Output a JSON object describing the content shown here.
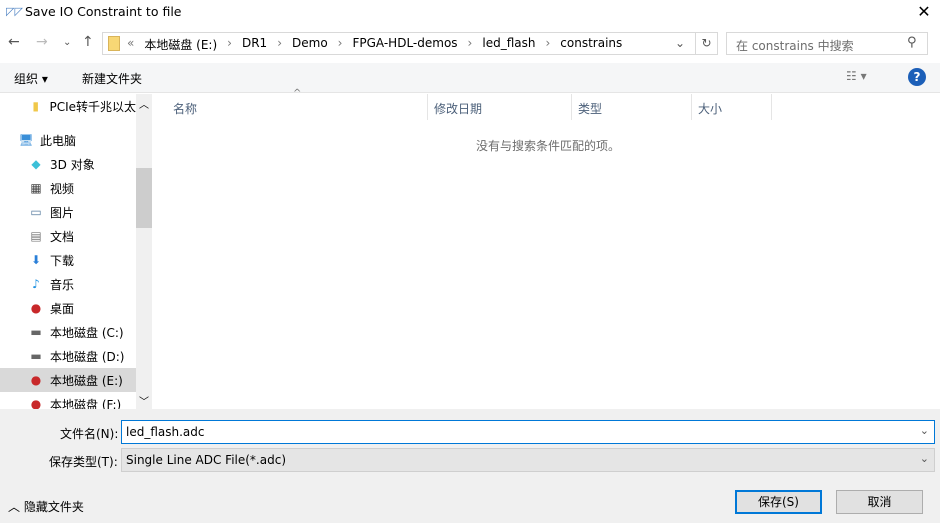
{
  "window": {
    "title": "Save IO Constraint to file",
    "close": "✕"
  },
  "address": {
    "overflow": "«",
    "crumbs": [
      "本地磁盘 (E:)",
      "DR1",
      "Demo",
      "FPGA-HDL-demos",
      "led_flash",
      "constrains"
    ]
  },
  "search": {
    "placeholder": "在 constrains 中搜索"
  },
  "toolbar": {
    "organize": "组织 ▾",
    "new_folder": "新建文件夹"
  },
  "tree": [
    {
      "label": "PCIe转千兆以太",
      "icon": "folder-icon"
    },
    {
      "label": "此电脑",
      "icon": "computer-icon"
    },
    {
      "label": "3D 对象",
      "icon": "3d-objects-icon"
    },
    {
      "label": "视频",
      "icon": "video-icon"
    },
    {
      "label": "图片",
      "icon": "pictures-icon"
    },
    {
      "label": "文档",
      "icon": "documents-icon"
    },
    {
      "label": "下载",
      "icon": "download-icon"
    },
    {
      "label": "音乐",
      "icon": "music-icon"
    },
    {
      "label": "桌面",
      "icon": "desktop-icon"
    },
    {
      "label": "本地磁盘 (C:)",
      "icon": "drive-icon"
    },
    {
      "label": "本地磁盘 (D:)",
      "icon": "drive-icon"
    },
    {
      "label": "本地磁盘 (E:)",
      "icon": "drive-warning-icon",
      "selected": true
    },
    {
      "label": "本地磁盘 (F:)",
      "icon": "drive-warning-icon"
    }
  ],
  "columns": [
    "名称",
    "修改日期",
    "类型",
    "大小"
  ],
  "empty_message": "没有与搜索条件匹配的项。",
  "form": {
    "filename_label": "文件名(N):",
    "filename": "led_flash.adc",
    "filetype_label": "保存类型(T):",
    "filetype": "Single Line ADC File(*.adc)"
  },
  "footer": {
    "hide_folders": "隐藏文件夹",
    "save": "保存(S)",
    "cancel": "取消"
  }
}
